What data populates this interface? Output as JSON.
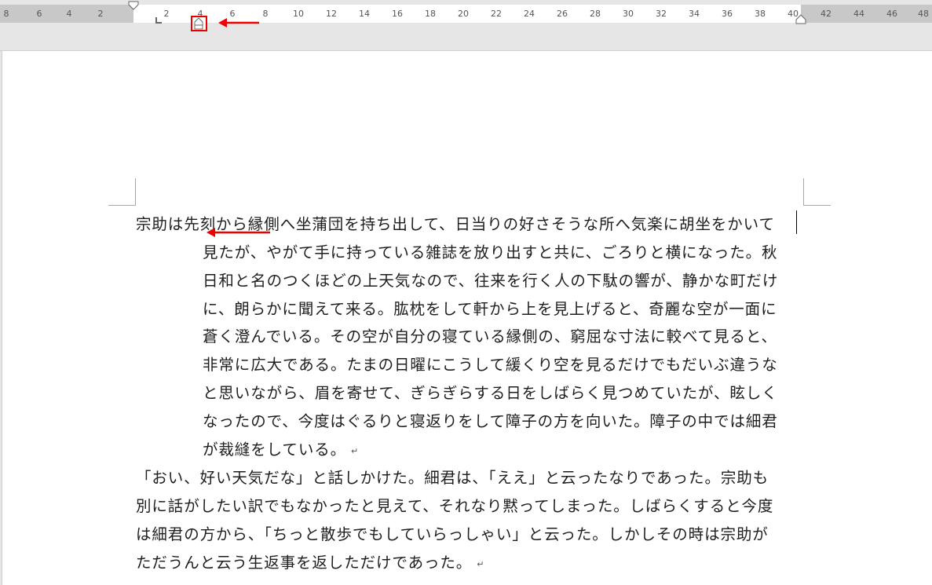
{
  "ruler": {
    "left_labels": [
      "8",
      "6",
      "4",
      "2"
    ],
    "right_labels": [
      "2",
      "4",
      "6",
      "8",
      "10",
      "12",
      "14",
      "16",
      "18",
      "20",
      "22",
      "24",
      "26",
      "28",
      "30",
      "32",
      "34",
      "36",
      "38",
      "40",
      "42",
      "44",
      "46",
      "48"
    ]
  },
  "document": {
    "paragraph1": [
      "宗助は先刻から縁側へ坐蒲団を持ち出して、日当りの好さそうな所へ気楽に胡坐をかいて",
      "見たが、やがて手に持っている雑誌を放り出すと共に、ごろりと横になった。秋",
      "日和と名のつくほどの上天気なので、往来を行く人の下駄の響が、静かな町だけ",
      "に、朗らかに聞えて来る。肱枕をして軒から上を見上げると、奇麗な空が一面に",
      "蒼く澄んでいる。その空が自分の寝ている縁側の、窮屈な寸法に較べて見ると、",
      "非常に広大である。たまの日曜にこうして緩くり空を見るだけでもだいぶ違うな",
      "と思いながら、眉を寄せて、ぎらぎらする日をしばらく見つめていたが、眩しく",
      "なったので、今度はぐるりと寝返りをして障子の方を向いた。障子の中では細君",
      "が裁縫をしている。"
    ],
    "paragraph2": [
      "「おい、好い天気だな」と話しかけた。細君は、「ええ」と云ったなりであった。宗助も",
      "別に話がしたい訳でもなかったと見えて、それなり黙ってしまった。しばらくすると今度",
      "は細君の方から、「ちっと散歩でもしていらっしゃい」と云った。しかしその時は宗助が",
      "ただうんと云う生返事を返しただけであった。"
    ],
    "paragraph_mark": "↵"
  }
}
